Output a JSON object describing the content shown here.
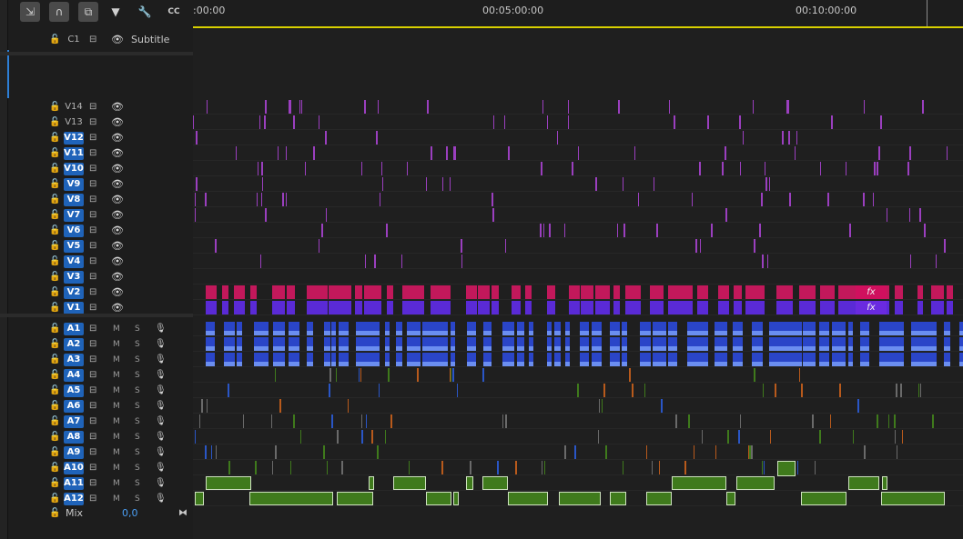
{
  "toolbar": {
    "tools": [
      {
        "name": "insert-edit-icon",
        "glyph": "⇲",
        "on": true
      },
      {
        "name": "snap-magnet-icon",
        "glyph": "∩",
        "on": true
      },
      {
        "name": "linked-selection-icon",
        "glyph": "⧉",
        "on": true
      },
      {
        "name": "add-marker-icon",
        "glyph": "▼",
        "on": false
      },
      {
        "name": "wrench-icon",
        "glyph": "🔧",
        "on": false
      },
      {
        "name": "captions-icon",
        "glyph": "CC",
        "on": false
      }
    ]
  },
  "ruler": {
    "labels": [
      ":00:00",
      "00:05:00:00",
      "00:10:00:00"
    ]
  },
  "caption_track": {
    "name": "C1",
    "label": "Subtitle"
  },
  "video_tracks": [
    "V14",
    "V13",
    "V12",
    "V11",
    "V10",
    "V9",
    "V8",
    "V7",
    "V6",
    "V5",
    "V4",
    "V3",
    "V2",
    "V1"
  ],
  "audio_tracks": [
    "A1",
    "A2",
    "A3",
    "A4",
    "A5",
    "A6",
    "A7",
    "A8",
    "A9",
    "A10",
    "A11",
    "A12"
  ],
  "audio_mute_label": "M",
  "audio_solo_label": "S",
  "mix": {
    "label": "Mix",
    "value": "0,0"
  },
  "fx_label": "fx",
  "colors": {
    "accent": "#1f63b9",
    "v2_clip": "#c2185b",
    "v1_clip": "#5a2ad6",
    "audio_clip": "#2a45c8",
    "green_clip": "#3f7a1c",
    "purple_marker": "#9b3fbf",
    "teal_marker": "#1e7c8c",
    "playhead_bar": "#d8d000"
  }
}
